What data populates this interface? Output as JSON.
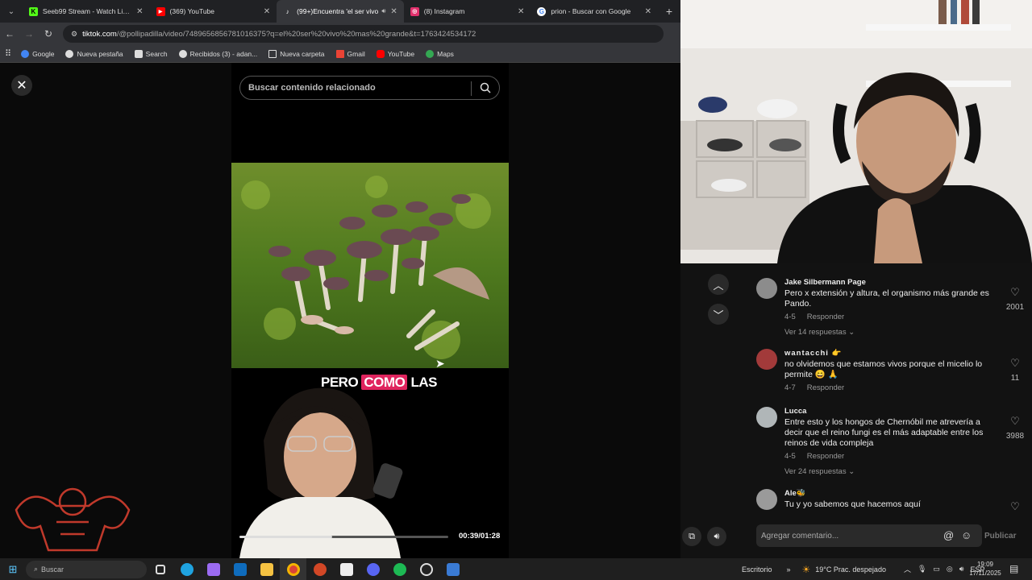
{
  "browser": {
    "tabs": [
      {
        "title": "Seeb99 Stream - Watch Live on",
        "icon": "kick-icon",
        "color": "#53fc18",
        "active": false
      },
      {
        "title": "(369) YouTube",
        "icon": "youtube-icon",
        "color": "#ff0000",
        "active": false
      },
      {
        "title": "(99+)Encuentra 'el ser vivo",
        "icon": "tiktok-icon",
        "color": "#ffffff",
        "active": true
      },
      {
        "title": "(8) Instagram",
        "icon": "instagram-icon",
        "color": "#e1306c",
        "active": false
      },
      {
        "title": "prion - Buscar con Google",
        "icon": "google-icon",
        "color": "#4285f4",
        "active": false
      }
    ],
    "url_domain": "tiktok.com",
    "url_path": "/@pollipadilla/video/7489656856781016375?q=el%20ser%20vivo%20mas%20grande&t=1763424534172",
    "bookmarks": [
      {
        "label": "Google",
        "color": "#4285f4"
      },
      {
        "label": "Nueva pestaña",
        "color": "#dddddd"
      },
      {
        "label": "Search",
        "color": "#dddddd"
      },
      {
        "label": "Recibidos (3) - adan...",
        "color": "#dddddd"
      },
      {
        "label": "Nueva carpeta",
        "color": "#f5c242"
      },
      {
        "label": "Gmail",
        "color": "#ea4335"
      },
      {
        "label": "YouTube",
        "color": "#ff0000"
      },
      {
        "label": "Maps",
        "color": "#34a853"
      }
    ]
  },
  "player": {
    "search_placeholder": "Buscar contenido relacionado",
    "caption_pre": "PERO ",
    "caption_highlight": "COMO",
    "caption_post": " LAS",
    "progress_fraction": 0.443,
    "timecode": "00:39/01:28"
  },
  "comments": [
    {
      "user": "Jake Silbermann Page",
      "text": "Pero x extensión y altura, el organismo más grande es Pando.",
      "date": "4-5",
      "reply": "Responder",
      "replies": "Ver 14 respuestas ⌄",
      "likes": "2001",
      "avatar_color": "#8c8c8c"
    },
    {
      "user": "wantacchi 👉",
      "text": "no olvidemos que estamos vivos porque el micelio lo permite 😄 🙏",
      "date": "4-7",
      "reply": "Responder",
      "replies": "",
      "likes": "11",
      "avatar_color": "#a23a3a"
    },
    {
      "user": "Lucca",
      "text": "Entre esto y los hongos de Chernóbil me atrevería a decir que el reino fungi es el más adaptable entre los reinos de vida compleja",
      "date": "4-5",
      "reply": "Responder",
      "replies": "Ver 24 respuestas ⌄",
      "likes": "3988",
      "avatar_color": "#b0b6b8"
    },
    {
      "user": "Ale🐝",
      "text": "Tu y yo sabemos que hacemos aquí",
      "date": "",
      "reply": "",
      "replies": "",
      "likes": "",
      "avatar_color": "#9a9a9a"
    }
  ],
  "comment_box": {
    "placeholder": "Agregar comentario...",
    "publish": "Publicar"
  },
  "taskbar": {
    "search": "Buscar",
    "desktop": "Escritorio",
    "weather": "19°C  Prac. despejado",
    "lang": "ESP",
    "time": "19:09",
    "date": "17/11/2025"
  }
}
